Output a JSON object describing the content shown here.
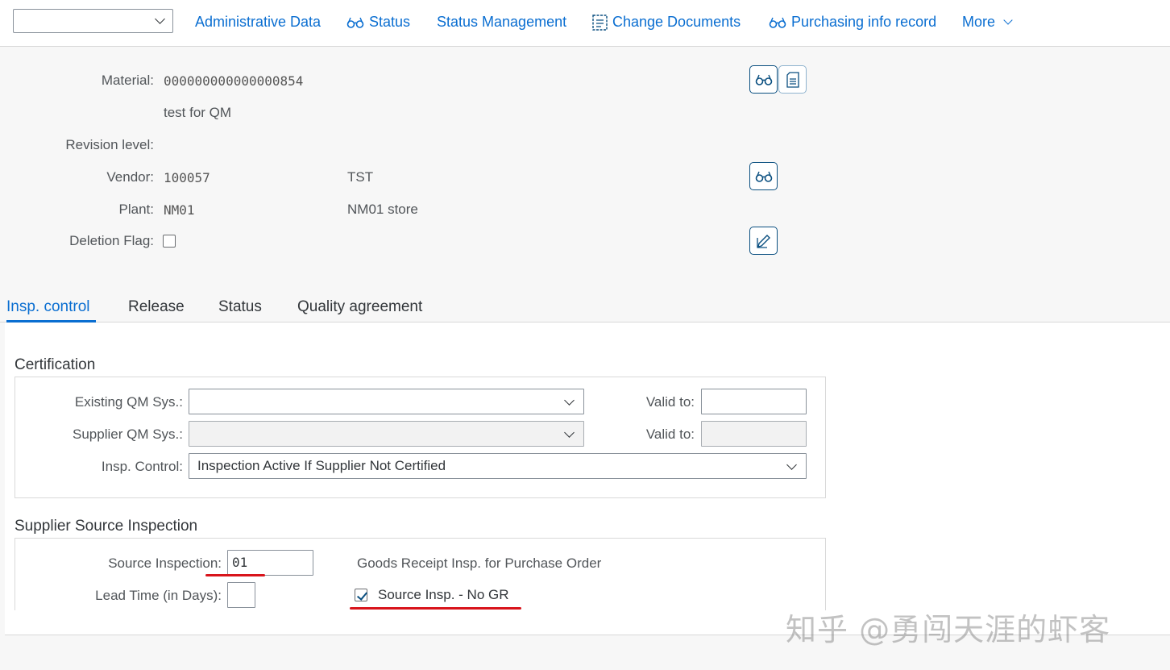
{
  "toolbar": {
    "select_value": "",
    "items": [
      {
        "label": "Administrative Data"
      },
      {
        "label": "Status"
      },
      {
        "label": "Status Management"
      },
      {
        "label": "Change Documents"
      },
      {
        "label": "Purchasing info record"
      },
      {
        "label": "More"
      }
    ]
  },
  "header": {
    "material_label": "Material:",
    "material_value": "000000000000000854",
    "material_desc": "test for QM",
    "revision_label": "Revision level:",
    "vendor_label": "Vendor:",
    "vendor_value": "100057",
    "vendor_name": "TST",
    "plant_label": "Plant:",
    "plant_value": "NM01",
    "plant_name": "NM01 store",
    "deletion_label": "Deletion Flag:",
    "deletion_checked": false
  },
  "tabs": [
    {
      "label": "Insp. control",
      "active": true
    },
    {
      "label": "Release",
      "active": false
    },
    {
      "label": "Status",
      "active": false
    },
    {
      "label": "Quality agreement",
      "active": false
    }
  ],
  "certification": {
    "title": "Certification",
    "existing_label": "Existing QM Sys.:",
    "existing_value": "",
    "valid_to_label_1": "Valid to:",
    "valid_to_value_1": "",
    "supplier_label": "Supplier QM Sys.:",
    "supplier_value": "",
    "valid_to_label_2": "Valid to:",
    "valid_to_value_2": "",
    "insp_control_label": "Insp. Control:",
    "insp_control_value": "Inspection Active If Supplier Not Certified"
  },
  "source_inspection": {
    "title": "Supplier Source Inspection",
    "source_label": "Source Inspection:",
    "source_value": "01",
    "lead_time_label": "Lead Time (in Days):",
    "lead_time_value": "",
    "goods_receipt_text": "Goods Receipt Insp. for Purchase Order",
    "no_gr_label": "Source Insp. - No GR",
    "no_gr_checked": true
  },
  "watermark": "知乎 @勇闯天涯的虾客",
  "colors": {
    "accent": "#0a6ed1",
    "highlight": "#d8141b"
  }
}
